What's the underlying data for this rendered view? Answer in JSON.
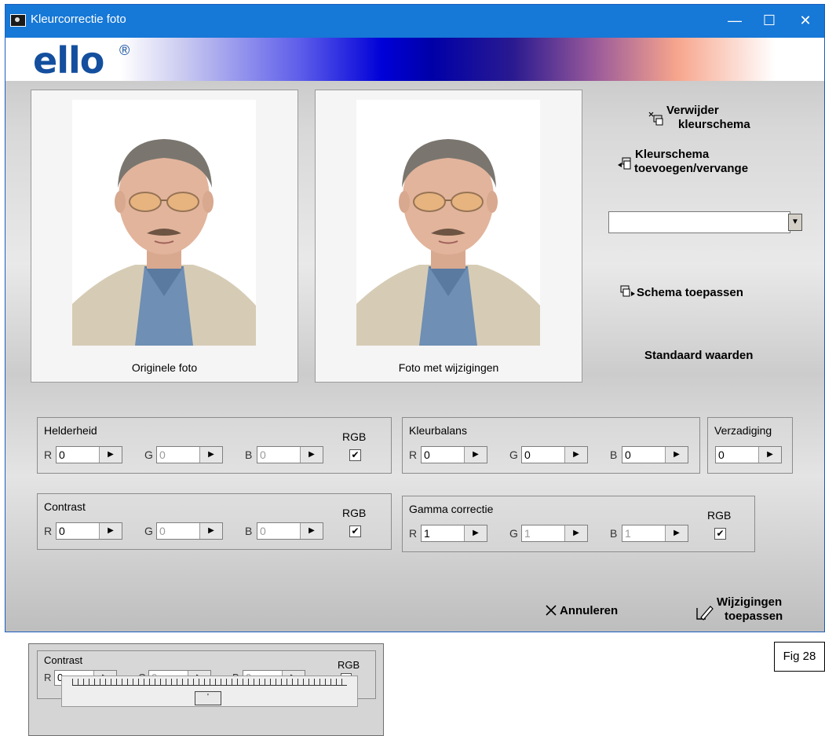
{
  "window": {
    "title": "Kleurcorrectie foto",
    "minimize": "—",
    "maximize": "☐",
    "close": "✕",
    "logo": "ello",
    "logo_mark": "®"
  },
  "photos": {
    "original_caption": "Originele foto",
    "modified_caption": "Foto met wijzigingen"
  },
  "actions": {
    "delete_scheme_line1": "Verwijder",
    "delete_scheme_line2": "kleurschema",
    "add_scheme_line1": "Kleurschema",
    "add_scheme_line2": "toevoegen/vervange",
    "scheme_select_value": "",
    "apply_scheme": "Schema toepassen",
    "default_values": "Standaard waarden",
    "cancel": "Annuleren",
    "apply_changes_line1": "Wijzigingen",
    "apply_changes_line2": "toepassen"
  },
  "helderheid": {
    "label": "Helderheid",
    "r_label": "R",
    "g_label": "G",
    "b_label": "B",
    "r": "0",
    "g": "0",
    "b": "0",
    "rgb_label": "RGB",
    "rgb_checked": "✔"
  },
  "kleurbalans": {
    "label": "Kleurbalans",
    "r_label": "R",
    "g_label": "G",
    "b_label": "B",
    "r": "0",
    "g": "0",
    "b": "0"
  },
  "verzadiging": {
    "label": "Verzadiging",
    "value": "0"
  },
  "contrast": {
    "label": "Contrast",
    "r_label": "R",
    "g_label": "G",
    "b_label": "B",
    "r": "0",
    "g": "0",
    "b": "0",
    "rgb_label": "RGB",
    "rgb_checked": "✔"
  },
  "gamma": {
    "label": "Gamma correctie",
    "r_label": "R",
    "g_label": "G",
    "b_label": "B",
    "r": "1",
    "g": "1",
    "b": "1",
    "rgb_label": "RGB",
    "rgb_checked": "✔"
  },
  "spin_arrow": "▶",
  "dropdown_arrow": "▼",
  "inset": {
    "label": "Contrast",
    "r_label": "R",
    "g_label": "G",
    "b_label": "B",
    "r": "0",
    "g": "0",
    "b": "0",
    "rgb_label": "RGB",
    "rgb_checked": "✔",
    "slider_thumb": "'"
  },
  "figure_label": "Fig 28",
  "colors": {
    "title_bar": "#1678d7",
    "logo": "#134f9e"
  }
}
